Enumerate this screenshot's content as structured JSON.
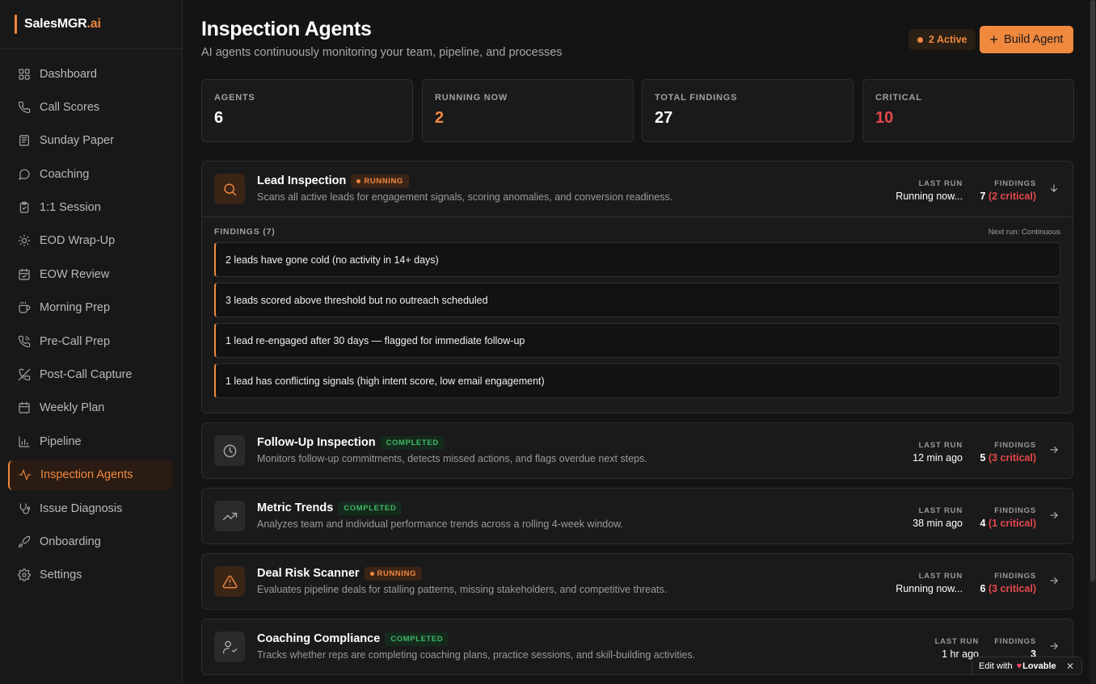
{
  "brand": {
    "name": "SalesMGR",
    "suffix": ".ai"
  },
  "sidebar": {
    "items": [
      {
        "label": "Dashboard",
        "icon": "grid-icon"
      },
      {
        "label": "Call Scores",
        "icon": "phone-icon"
      },
      {
        "label": "Sunday Paper",
        "icon": "newspaper-icon"
      },
      {
        "label": "Coaching",
        "icon": "message-circle-icon"
      },
      {
        "label": "1:1 Session",
        "icon": "clipboard-icon"
      },
      {
        "label": "EOD Wrap-Up",
        "icon": "sun-icon"
      },
      {
        "label": "EOW Review",
        "icon": "calendar-check-icon"
      },
      {
        "label": "Morning Prep",
        "icon": "coffee-icon"
      },
      {
        "label": "Pre-Call Prep",
        "icon": "phone-outgoing-icon"
      },
      {
        "label": "Post-Call Capture",
        "icon": "phone-off-icon"
      },
      {
        "label": "Weekly Plan",
        "icon": "calendar-icon"
      },
      {
        "label": "Pipeline",
        "icon": "bar-chart-icon"
      },
      {
        "label": "Inspection Agents",
        "icon": "activity-icon",
        "active": true
      },
      {
        "label": "Issue Diagnosis",
        "icon": "stethoscope-icon"
      },
      {
        "label": "Onboarding",
        "icon": "rocket-icon"
      },
      {
        "label": "Settings",
        "icon": "gear-icon"
      }
    ]
  },
  "header": {
    "title": "Inspection Agents",
    "subtitle": "AI agents continuously monitoring your team, pipeline, and processes",
    "active_badge": "2 Active",
    "build_button": "Build Agent"
  },
  "stats": [
    {
      "label": "AGENTS",
      "value": "6",
      "color": "#ffffff"
    },
    {
      "label": "RUNNING NOW",
      "value": "2",
      "color": "#f0883e"
    },
    {
      "label": "TOTAL FINDINGS",
      "value": "27",
      "color": "#ffffff"
    },
    {
      "label": "CRITICAL",
      "value": "10",
      "color": "#e5484d"
    }
  ],
  "meta_labels": {
    "last_run": "LAST RUN",
    "findings": "FINDINGS"
  },
  "agents": [
    {
      "name": "Lead Inspection",
      "status": "RUNNING",
      "description": "Scans all active leads for engagement signals, scoring anomalies, and conversion readiness.",
      "last_run": "Running now...",
      "findings": "7",
      "critical": "(2 critical)",
      "icon": "search-icon",
      "expanded": true,
      "findings_title": "FINDINGS (7)",
      "next_run": "Next run: Continuous",
      "findings_list": [
        "2 leads have gone cold (no activity in 14+ days)",
        "3 leads scored above threshold but no outreach scheduled",
        "1 lead re-engaged after 30 days — flagged for immediate follow-up",
        "1 lead has conflicting signals (high intent score, low email engagement)"
      ]
    },
    {
      "name": "Follow-Up Inspection",
      "status": "COMPLETED",
      "description": "Monitors follow-up commitments, detects missed actions, and flags overdue next steps.",
      "last_run": "12 min ago",
      "findings": "5",
      "critical": "(3 critical)",
      "icon": "clock-icon"
    },
    {
      "name": "Metric Trends",
      "status": "COMPLETED",
      "description": "Analyzes team and individual performance trends across a rolling 4-week window.",
      "last_run": "38 min ago",
      "findings": "4",
      "critical": "(1 critical)",
      "icon": "trending-up-icon"
    },
    {
      "name": "Deal Risk Scanner",
      "status": "RUNNING",
      "description": "Evaluates pipeline deals for stalling patterns, missing stakeholders, and competitive threats.",
      "last_run": "Running now...",
      "findings": "6",
      "critical": "(3 critical)",
      "icon": "alert-triangle-icon"
    },
    {
      "name": "Coaching Compliance",
      "status": "COMPLETED",
      "description": "Tracks whether reps are completing coaching plans, practice sessions, and skill-building activities.",
      "last_run": "1 hr ago",
      "findings": "3",
      "critical": "",
      "icon": "user-check-icon"
    }
  ],
  "lovable": {
    "prefix": "Edit with",
    "brand": "Lovable",
    "close": "✕"
  },
  "colors": {
    "accent": "#f0883e",
    "critical": "#e5484d",
    "success": "#3fb866"
  }
}
